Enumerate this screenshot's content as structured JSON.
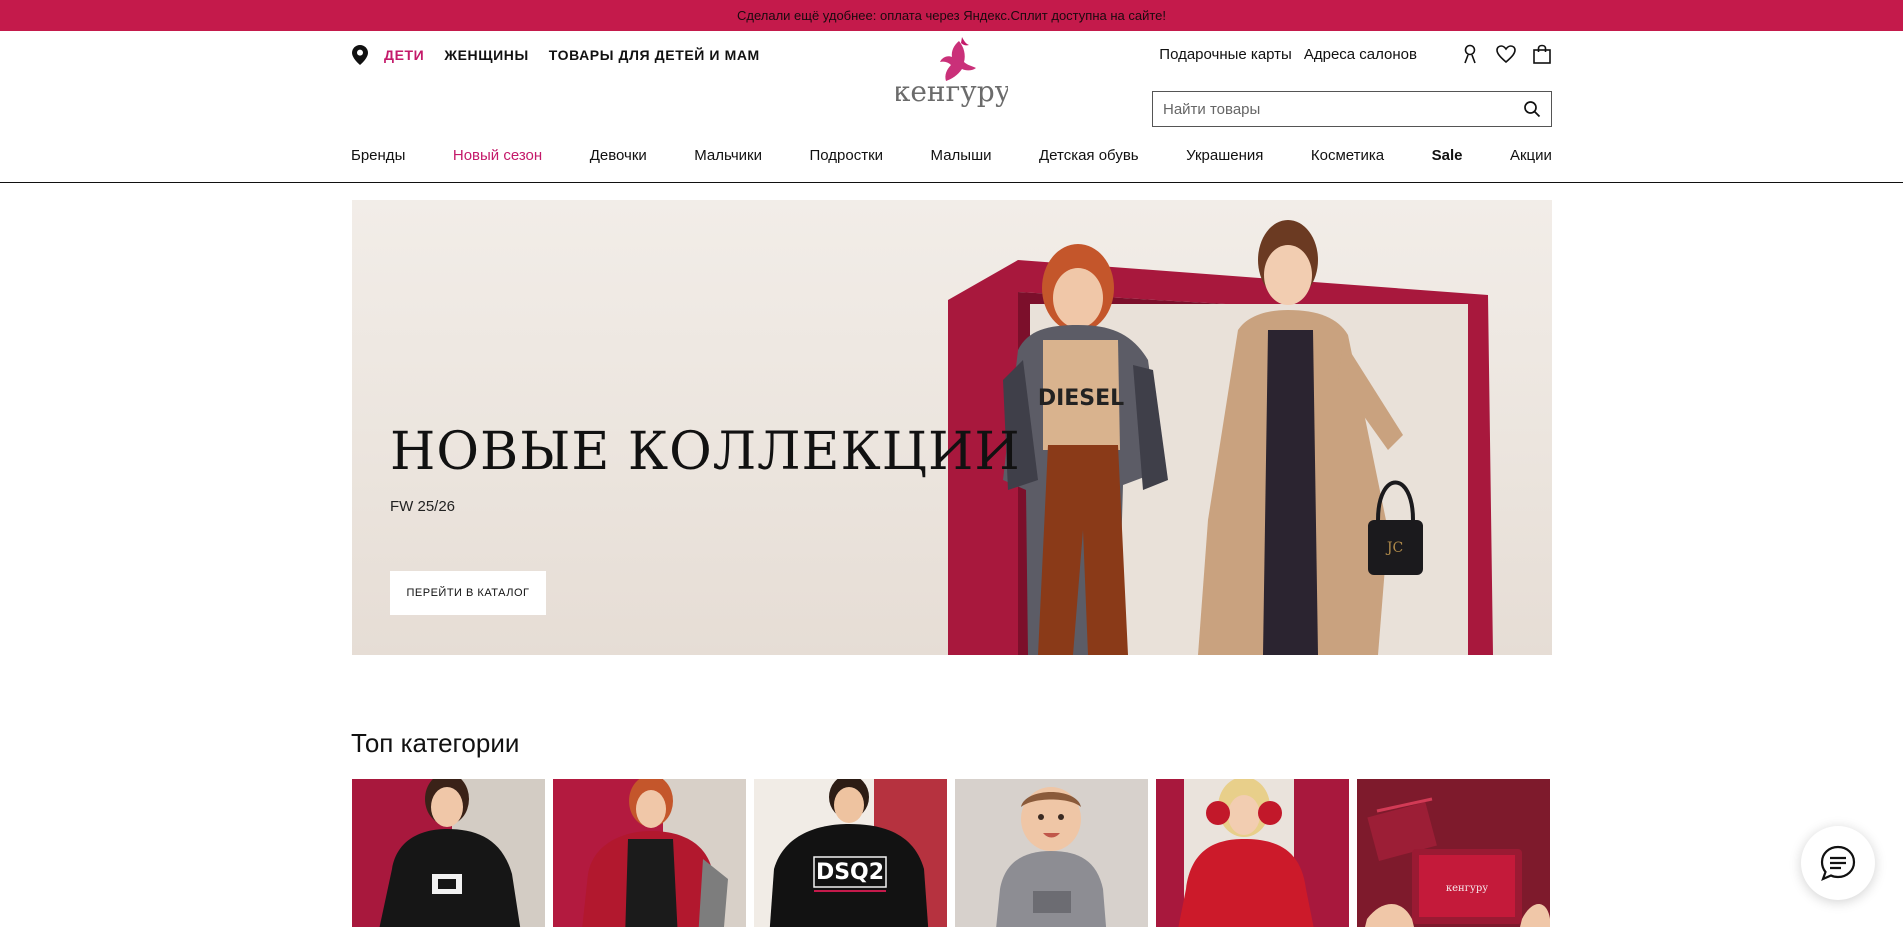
{
  "promo": {
    "text": "Сделали ещё удобнее: оплата через Яндекс.Сплит доступна на сайте!"
  },
  "header": {
    "segments": [
      {
        "label": "ДЕТИ",
        "active": true
      },
      {
        "label": "ЖЕНЩИНЫ",
        "active": false
      },
      {
        "label": "ТОВАРЫ ДЛЯ ДЕТЕЙ И МАМ",
        "active": false
      }
    ],
    "logo_text": "кенгуру",
    "utility_links": [
      "Подарочные карты",
      "Адреса салонов"
    ],
    "icons": [
      "location-pin-icon",
      "user-icon",
      "heart-icon",
      "bag-icon",
      "search-icon"
    ],
    "search": {
      "placeholder": "Найти товары"
    }
  },
  "nav": {
    "items": [
      {
        "label": "Бренды"
      },
      {
        "label": "Новый сезон",
        "highlight": true
      },
      {
        "label": "Девочки"
      },
      {
        "label": "Мальчики"
      },
      {
        "label": "Подростки"
      },
      {
        "label": "Малыши"
      },
      {
        "label": "Детская обувь"
      },
      {
        "label": "Украшения"
      },
      {
        "label": "Косметика"
      },
      {
        "label": "Sale",
        "bold": true
      },
      {
        "label": "Акции"
      }
    ]
  },
  "hero": {
    "title": "НОВЫЕ КОЛЛЕКЦИИ",
    "subtitle": "FW 25/26",
    "button": "ПЕРЕЙТИ В КАТАЛОГ",
    "jacket_print": "DIESEL"
  },
  "top_categories": {
    "title": "Топ категории",
    "cards": [
      {
        "print": ""
      },
      {
        "print": ""
      },
      {
        "print": "DSQ2"
      },
      {
        "print": ""
      },
      {
        "print": ""
      },
      {
        "print": "кенгуру"
      }
    ]
  },
  "colors": {
    "brand": "#c41a4b",
    "accent": "#c41a6a"
  }
}
